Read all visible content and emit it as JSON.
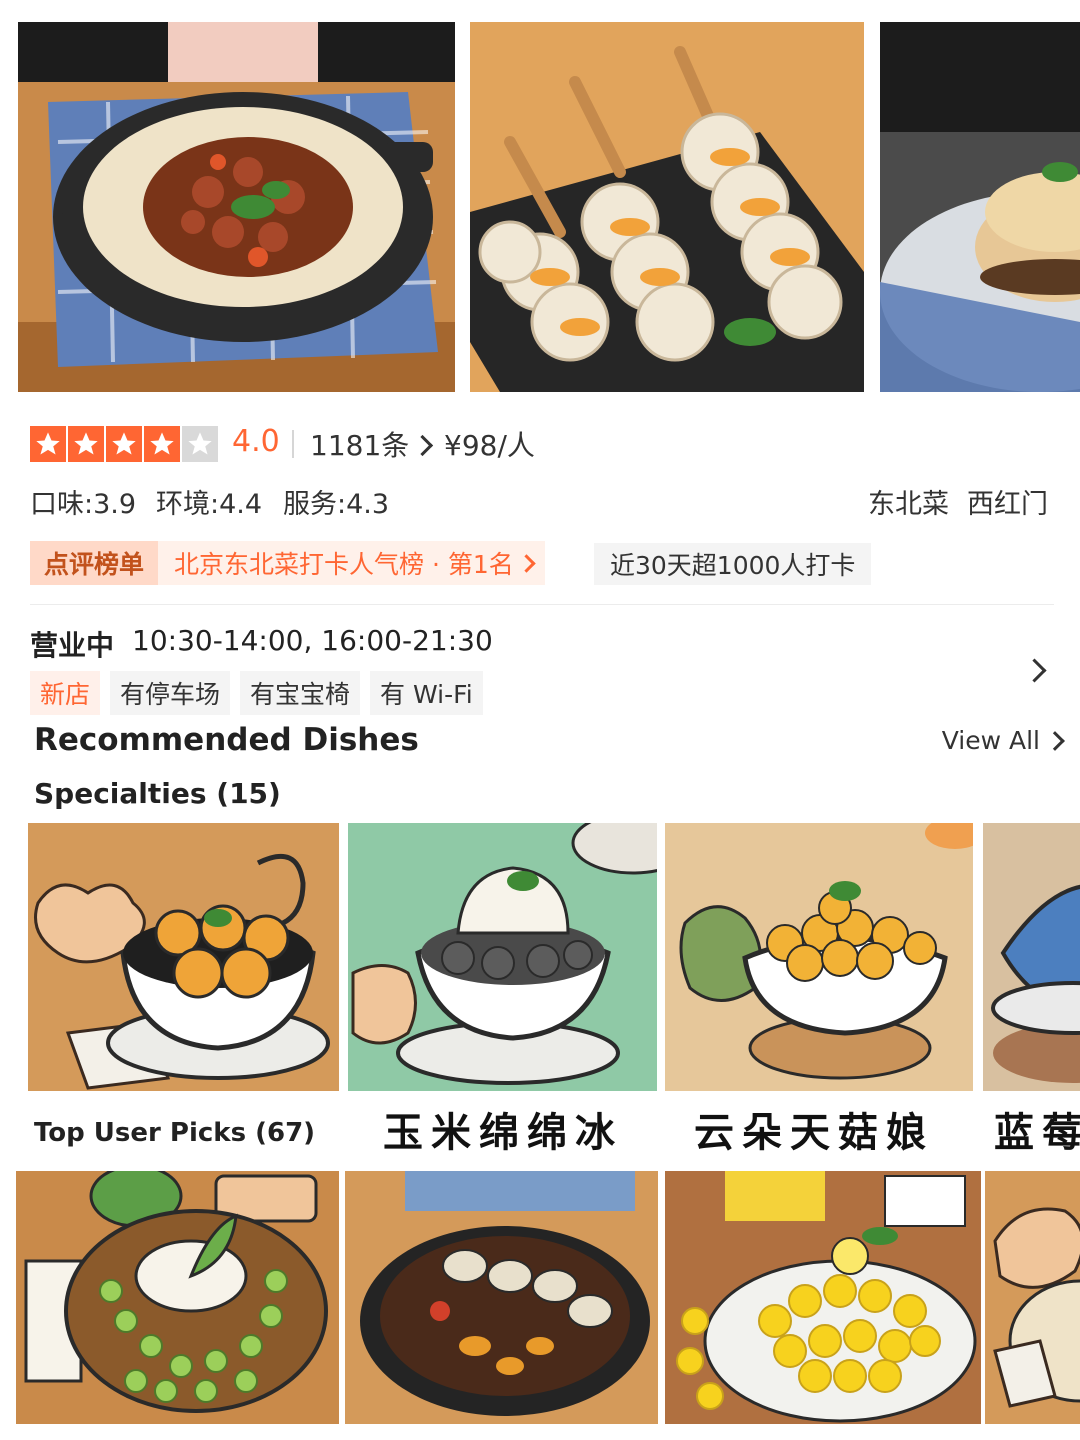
{
  "hero_photos": [
    {
      "name": "stew-pot-photo",
      "icon": "braised-pork-pot"
    },
    {
      "name": "skewers-photo",
      "icon": "glutinous-skewers"
    },
    {
      "name": "bun-photo",
      "icon": "stuffed-bun"
    }
  ],
  "rating": {
    "stars_total": 5,
    "stars_filled": 4,
    "score": "4.0",
    "reviews": "1181条",
    "price": "¥98/人",
    "star_color": "#ff6633"
  },
  "sub_scores": {
    "taste": "口味:3.9",
    "environment": "环境:4.4",
    "service": "服务:4.3"
  },
  "tags": {
    "cuisine": "东北菜",
    "area": "西红门"
  },
  "ranking": {
    "badge": "点评榜单",
    "text": "北京东北菜打卡人气榜 · 第1名",
    "checkin": "近30天超1000人打卡"
  },
  "hours": {
    "status": "营业中",
    "time": "10:30-14:00, 16:00-21:30"
  },
  "facilities": [
    "新店",
    "有停车场",
    "有宝宝椅",
    "有 Wi-Fi"
  ],
  "recommended": {
    "title": "Recommended Dishes",
    "view_all": "View All",
    "specialties_label": "Specialties (15)",
    "user_picks_label": "Top User Picks (67)",
    "dish_names": [
      "玉米绵绵冰",
      "云朵天菇娘",
      "蓝莓"
    ]
  },
  "accent_color": "#ff6633"
}
